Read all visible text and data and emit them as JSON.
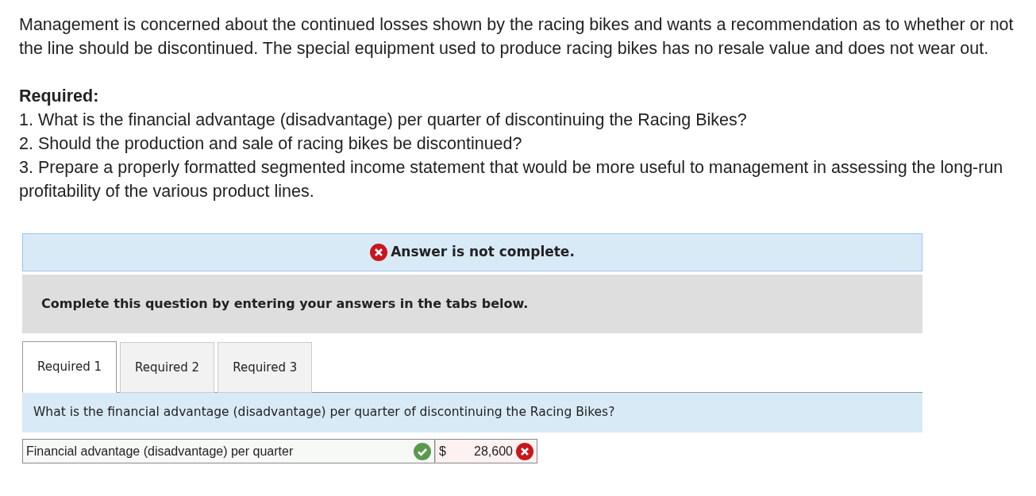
{
  "intro": "Management is concerned about the continued losses shown by the racing bikes and wants a recommendation as to whether or not the line should be discontinued. The special equipment used to produce racing bikes has no resale value and does not wear out.",
  "required_heading": "Required:",
  "requirements": [
    "1. What is the financial advantage (disadvantage) per quarter of discontinuing the Racing Bikes?",
    "2. Should the production and sale of racing bikes be discontinued?",
    "3. Prepare a properly formatted segmented income statement that would be more useful to management in assessing the long-run profitability of the various product lines."
  ],
  "answer_status": {
    "text": "Answer is not complete.",
    "complete": false
  },
  "instructions": "Complete this question by entering your answers in the tabs below.",
  "tabs": [
    {
      "label": "Required 1",
      "selected": true
    },
    {
      "label": "Required 2",
      "selected": false
    },
    {
      "label": "Required 3",
      "selected": false
    }
  ],
  "question": "What is the financial advantage (disadvantage) per quarter of discontinuing the Racing Bikes?",
  "answer_row": {
    "label": "Financial advantage (disadvantage) per quarter",
    "label_correct": true,
    "currency": "$",
    "value": "28,600",
    "value_correct": false
  }
}
